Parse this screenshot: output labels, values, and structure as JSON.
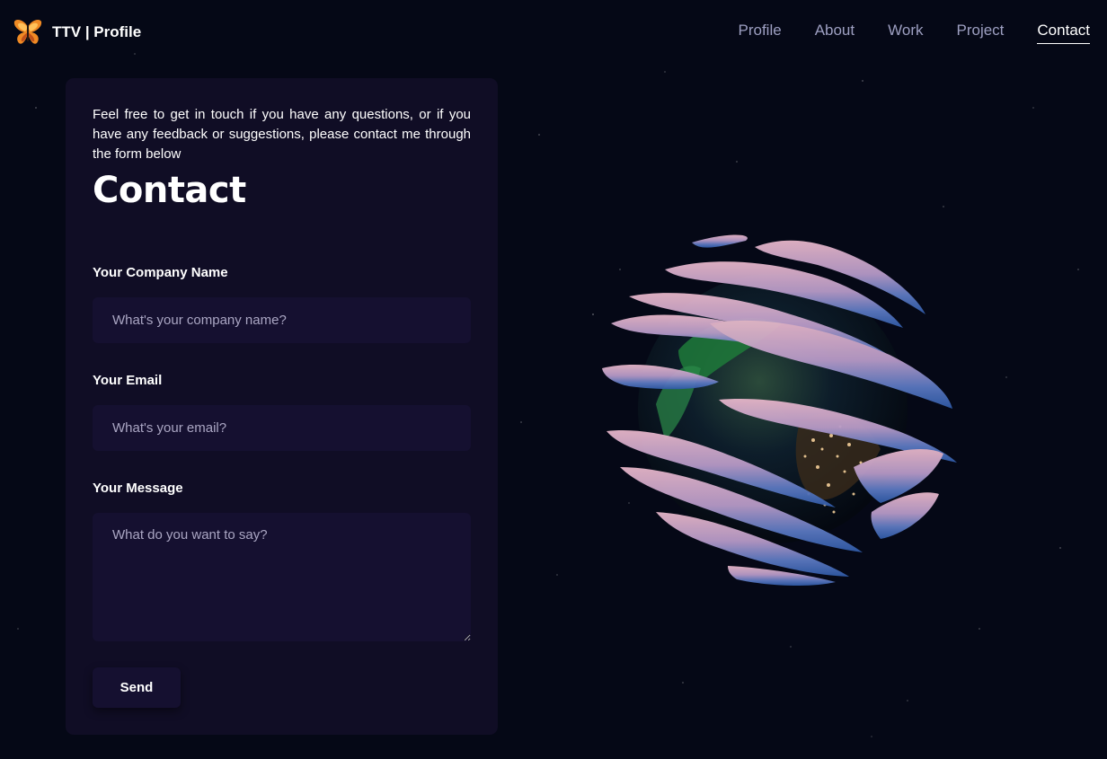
{
  "navbar": {
    "brand_prefix": "TTV",
    "brand_suffix": " | Profile",
    "links": [
      {
        "label": "Profile",
        "active": false
      },
      {
        "label": "About",
        "active": false
      },
      {
        "label": "Work",
        "active": false
      },
      {
        "label": "Project",
        "active": false
      },
      {
        "label": "Contact",
        "active": true
      }
    ]
  },
  "contact": {
    "intro": "Feel free to get in touch if you have any questions, or if you have any feedback or suggestions, please contact me through the form below",
    "title": "Contact",
    "company_label": "Your Company Name",
    "company_placeholder": "What's your company name?",
    "company_value": "",
    "email_label": "Your Email",
    "email_placeholder": "What's your email?",
    "email_value": "",
    "message_label": "Your Message",
    "message_placeholder": "What do you want to say?",
    "message_value": "",
    "send_label": "Send"
  },
  "icons": {
    "brand_logo": "butterfly-logo-icon",
    "globe": "earth-globe-3d-icon"
  },
  "colors": {
    "background": "#050816",
    "card": "#100d25",
    "field": "#151030",
    "nav_inactive": "#9d9fc1",
    "placeholder": "#aaa6c3",
    "logo_orange": "#f08a24"
  }
}
